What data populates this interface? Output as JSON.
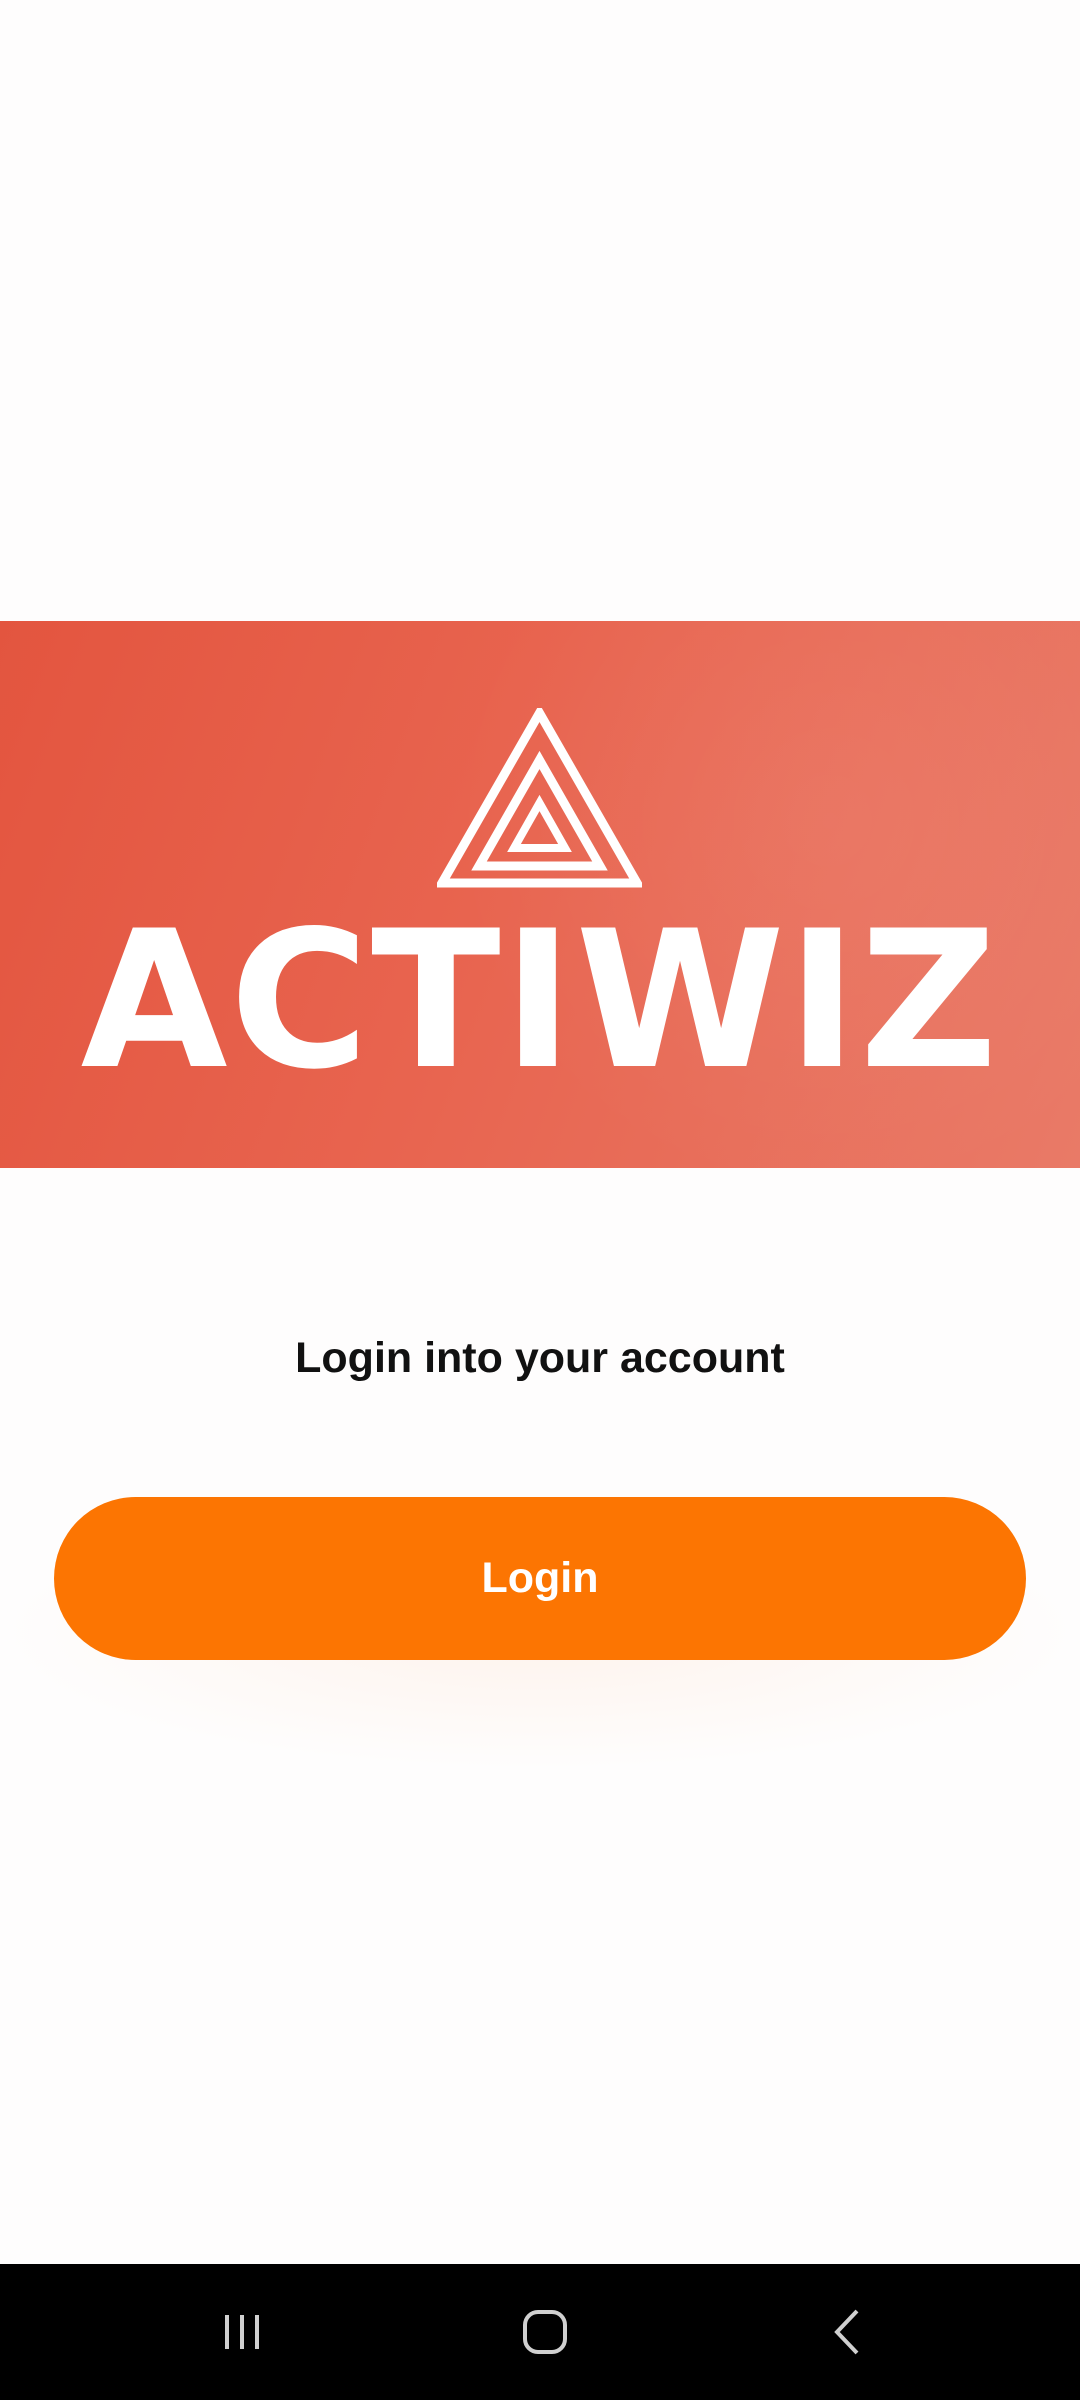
{
  "brand": {
    "name": "ACTIWIZ",
    "logo_icon": "triangle-logo-icon",
    "banner_colors": [
      "#e3553f",
      "#e97a67"
    ]
  },
  "login": {
    "subtitle": "Login into your account",
    "button_label": "Login",
    "button_color": "#fc7502"
  },
  "navbar": {
    "recents_icon": "recent-apps-icon",
    "home_icon": "home-icon",
    "back_icon": "back-icon"
  }
}
